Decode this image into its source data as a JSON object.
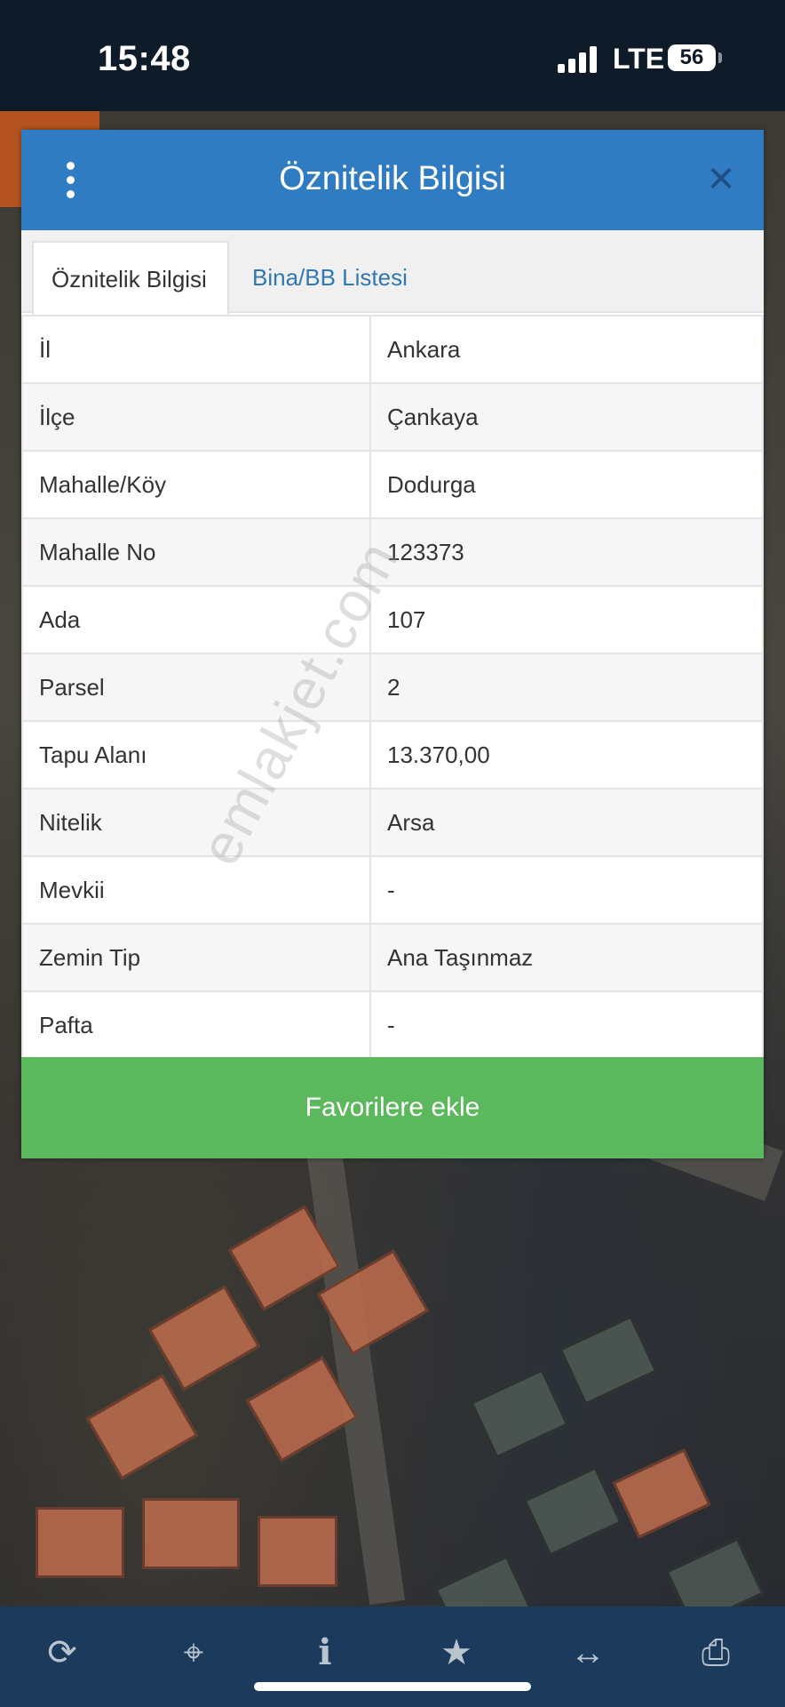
{
  "status_bar": {
    "time": "15:48",
    "network": "LTE",
    "battery": "56"
  },
  "dialog": {
    "title": "Öznitelik Bilgisi",
    "tabs": [
      {
        "label": "Öznitelik Bilgisi",
        "active": true
      },
      {
        "label": "Bina/BB Listesi",
        "active": false
      }
    ],
    "rows": [
      {
        "key": "İl",
        "value": "Ankara"
      },
      {
        "key": "İlçe",
        "value": "Çankaya"
      },
      {
        "key": "Mahalle/Köy",
        "value": "Dodurga"
      },
      {
        "key": "Mahalle No",
        "value": "123373"
      },
      {
        "key": "Ada",
        "value": "107"
      },
      {
        "key": "Parsel",
        "value": "2"
      },
      {
        "key": "Tapu Alanı",
        "value": "13.370,00"
      },
      {
        "key": "Nitelik",
        "value": "Arsa"
      },
      {
        "key": "Mevkii",
        "value": "-"
      },
      {
        "key": "Zemin Tip",
        "value": "Ana Taşınmaz"
      },
      {
        "key": "Pafta",
        "value": "-"
      }
    ],
    "favorite_button": "Favorilere ekle"
  },
  "watermark": "emlakjet.com",
  "toolbar": {
    "icons": [
      "refresh-icon",
      "locate-icon",
      "info-icon",
      "star-icon",
      "measure-icon",
      "print-icon"
    ]
  },
  "colors": {
    "header": "#2f7cc2",
    "button": "#5cb85c",
    "toolbar": "#1c3b5c"
  }
}
